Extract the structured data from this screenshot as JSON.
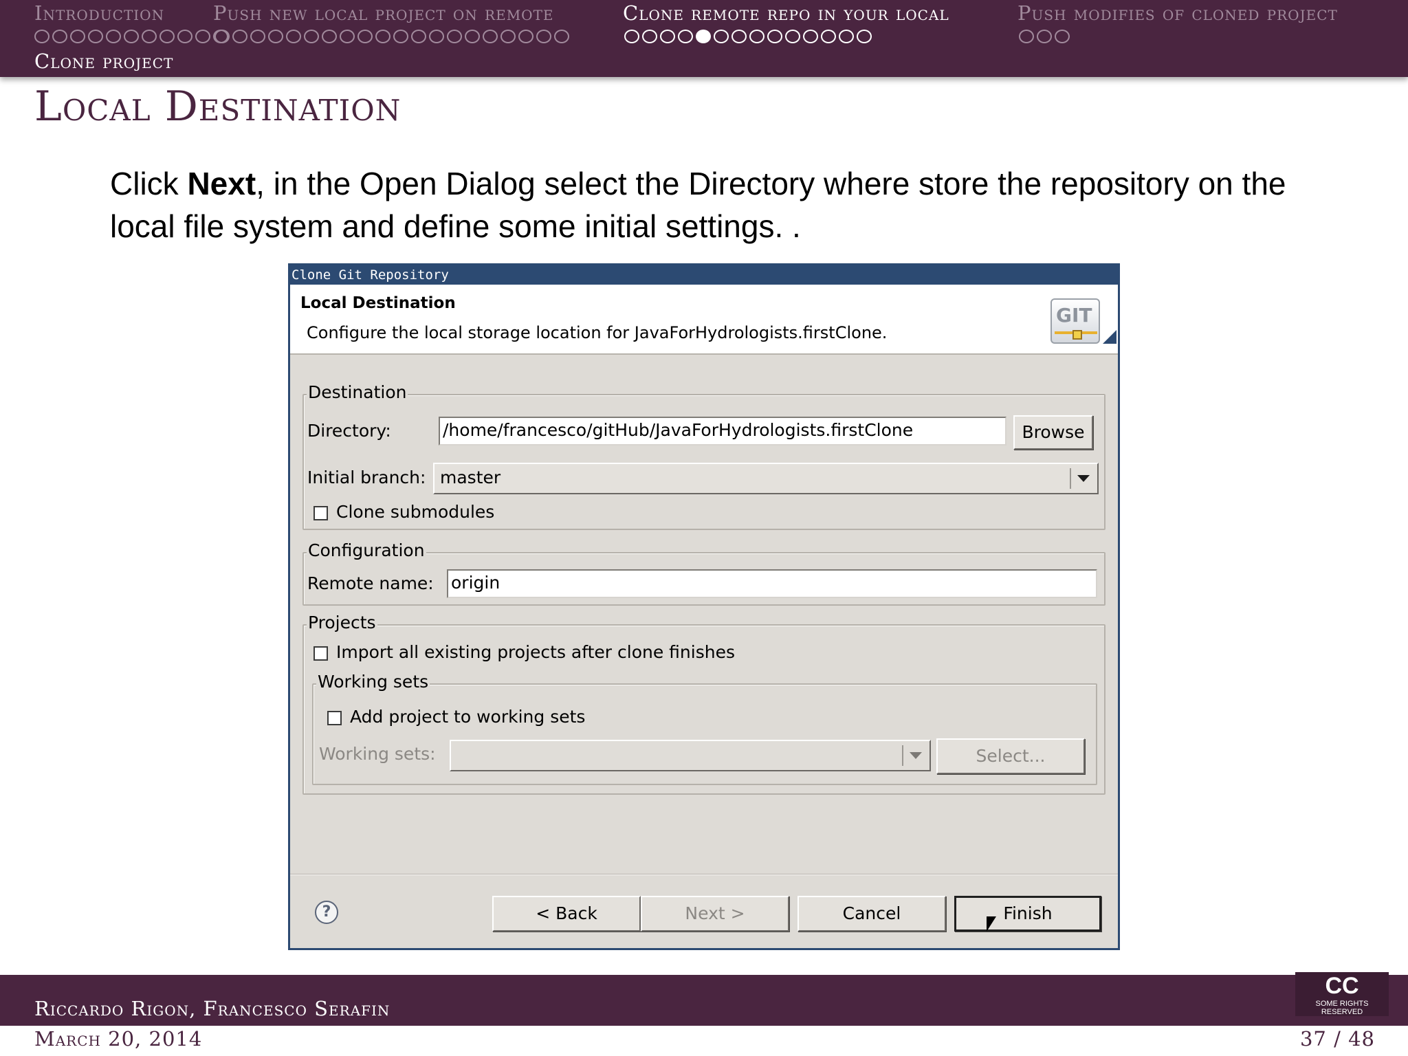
{
  "nav": {
    "sections": [
      {
        "label": "Introduction",
        "dots": 11,
        "current_dot": -1,
        "active": false
      },
      {
        "label": "Push new local project on remote",
        "dots": 20,
        "current_dot": -1,
        "active": false
      },
      {
        "label": "Clone remote repo in your local",
        "dots": 14,
        "current_dot": 4,
        "active": true
      },
      {
        "label": "Push modifies of cloned project",
        "dots": 3,
        "current_dot": -1,
        "active": false
      }
    ],
    "subsection": "Clone project"
  },
  "slide": {
    "title": "Local Destination",
    "text_before_bold": "Click ",
    "text_bold": "Next",
    "text_after_bold": ", in the Open Dialog select the Directory where store the repository on the local file system and define some initial settings.  ."
  },
  "dialog": {
    "window_title": "Clone Git Repository",
    "heading": "Local Destination",
    "description": "Configure the local storage location for JavaForHydrologists.firstClone.",
    "logo_text": "GIT",
    "destination": {
      "legend": "Destination",
      "directory_label": "Directory:",
      "directory_value": "/home/francesco/gitHub/JavaForHydrologists.firstClone",
      "browse_label": "Browse",
      "branch_label": "Initial branch:",
      "branch_value": "master",
      "clone_submodules_label": "Clone submodules",
      "clone_submodules_checked": false
    },
    "configuration": {
      "legend": "Configuration",
      "remote_name_label": "Remote name:",
      "remote_name_value": "origin"
    },
    "projects": {
      "legend": "Projects",
      "import_label": "Import all existing projects after clone finishes",
      "import_checked": false,
      "working_sets_legend": "Working sets",
      "add_to_working_sets_label": "Add project to working sets",
      "add_to_working_sets_checked": false,
      "working_sets_label": "Working sets:",
      "working_sets_value": "",
      "select_label": "Select..."
    },
    "buttons": {
      "help": "?",
      "back": "< Back",
      "next": "Next >",
      "cancel": "Cancel",
      "finish": "Finish"
    }
  },
  "footer": {
    "authors": "Riccardo Rigon, Francesco Serafin",
    "date": "March 20, 2014",
    "page": "37 / 48",
    "license_logo": "CC",
    "license_text": "SOME RIGHTS RESERVED"
  },
  "colors": {
    "theme": "#4a2540",
    "dialog_title": "#2c4a72",
    "dialog_bg": "#dedbd6"
  }
}
